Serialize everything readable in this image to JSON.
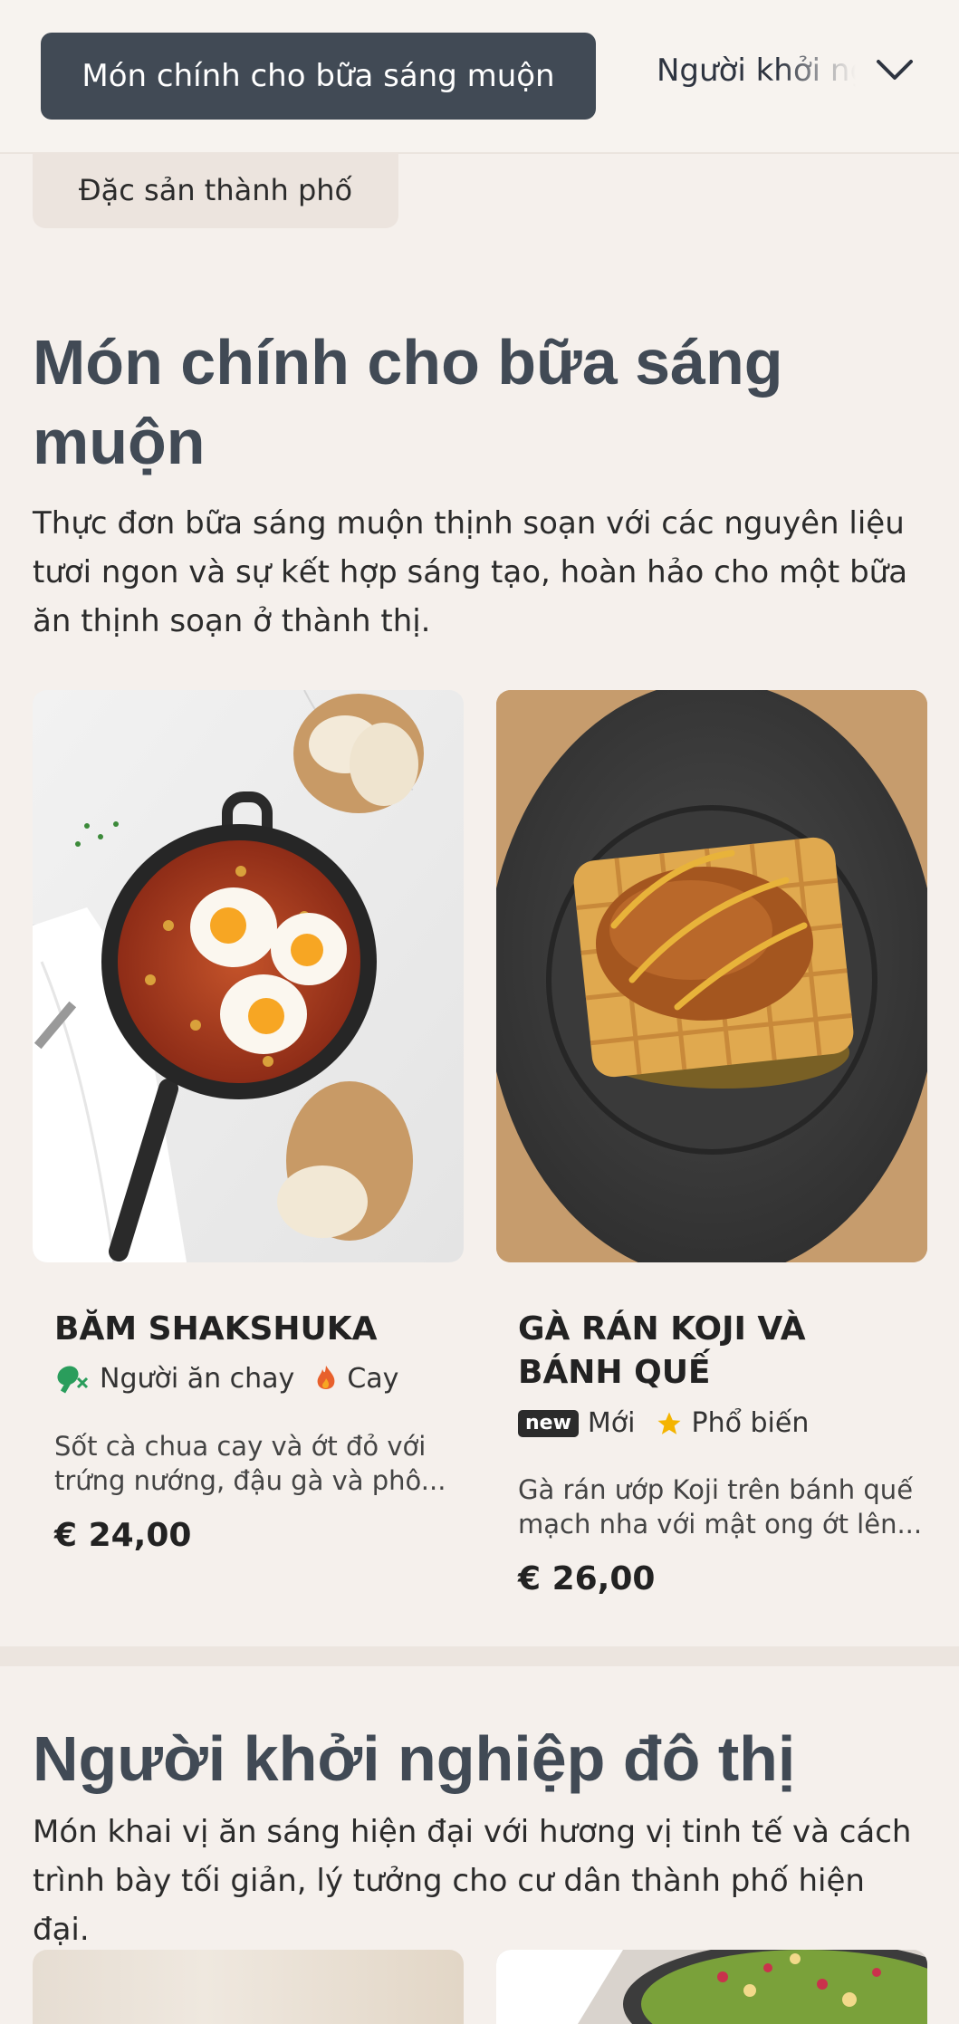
{
  "nav": {
    "active_category": "Món chính cho bữa sáng muộn",
    "next_category": "Người khởi nghiệp đô thị",
    "prev_category": "Đặc sản thành phố"
  },
  "sections": [
    {
      "title": "Món chính cho bữa sáng muộn",
      "description": "Thực đơn bữa sáng muộn thịnh soạn với các nguyên liệu tươi ngon và sự kết hợp sáng tạo, hoàn hảo cho một bữa ăn thịnh soạn ở thành thị.",
      "items": [
        {
          "name": "BĂM SHAKSHUKA",
          "tags": [
            {
              "icon": "vegetarian-leaf-icon",
              "label": "Người ăn chay",
              "color": "#2a9d5c"
            },
            {
              "icon": "flame-icon",
              "label": "Cay",
              "color": "#e8602c"
            }
          ],
          "description": "Sốt cà chua cay và ớt đỏ với trứng nướng, đậu gà và phô...",
          "price": "€ 24,00"
        },
        {
          "name": "GÀ RÁN KOJI VÀ BÁNH QUẾ",
          "tags": [
            {
              "icon": "new-badge",
              "badge": "new",
              "label": "Mới"
            },
            {
              "icon": "star-icon",
              "label": "Phổ biến",
              "color": "#f4b400"
            }
          ],
          "description": "Gà rán ướp Koji trên bánh quế mạch nha với mật ong ớt lên...",
          "price": "€ 26,00"
        }
      ]
    },
    {
      "title": "Người khởi nghiệp đô thị",
      "description": "Món khai vị ăn sáng hiện đại với hương vị tinh tế và cách trình bày tối giản, lý tưởng cho cư dân thành phố hiện đại."
    }
  ],
  "colors": {
    "background": "#f5f0ec",
    "chip_active": "#414a55",
    "heading": "#414a55"
  }
}
